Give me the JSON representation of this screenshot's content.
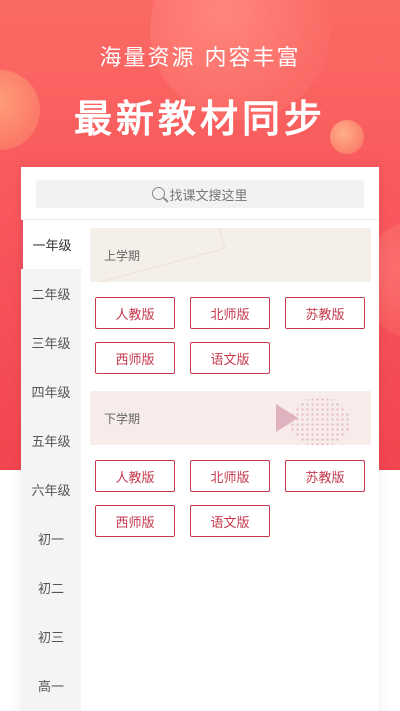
{
  "hero": {
    "tagline": "海量资源 内容丰富",
    "headline": "最新教材同步"
  },
  "search": {
    "placeholder": "找课文搜这里",
    "icon": "search-icon"
  },
  "grades": [
    {
      "label": "一年级",
      "active": true
    },
    {
      "label": "二年级"
    },
    {
      "label": "三年级"
    },
    {
      "label": "四年级"
    },
    {
      "label": "五年级"
    },
    {
      "label": "六年级"
    },
    {
      "label": "初一"
    },
    {
      "label": "初二"
    },
    {
      "label": "初三"
    },
    {
      "label": "高一"
    }
  ],
  "terms": [
    {
      "label": "上学期",
      "publishers": [
        "人教版",
        "北师版",
        "苏教版",
        "西师版",
        "语文版"
      ]
    },
    {
      "label": "下学期",
      "publishers": [
        "人教版",
        "北师版",
        "苏教版",
        "西师版",
        "语文版"
      ]
    }
  ],
  "colors": {
    "accent": "#c6384c",
    "hero": "#f7535a",
    "sidebar_bg": "#f4f4f6"
  }
}
